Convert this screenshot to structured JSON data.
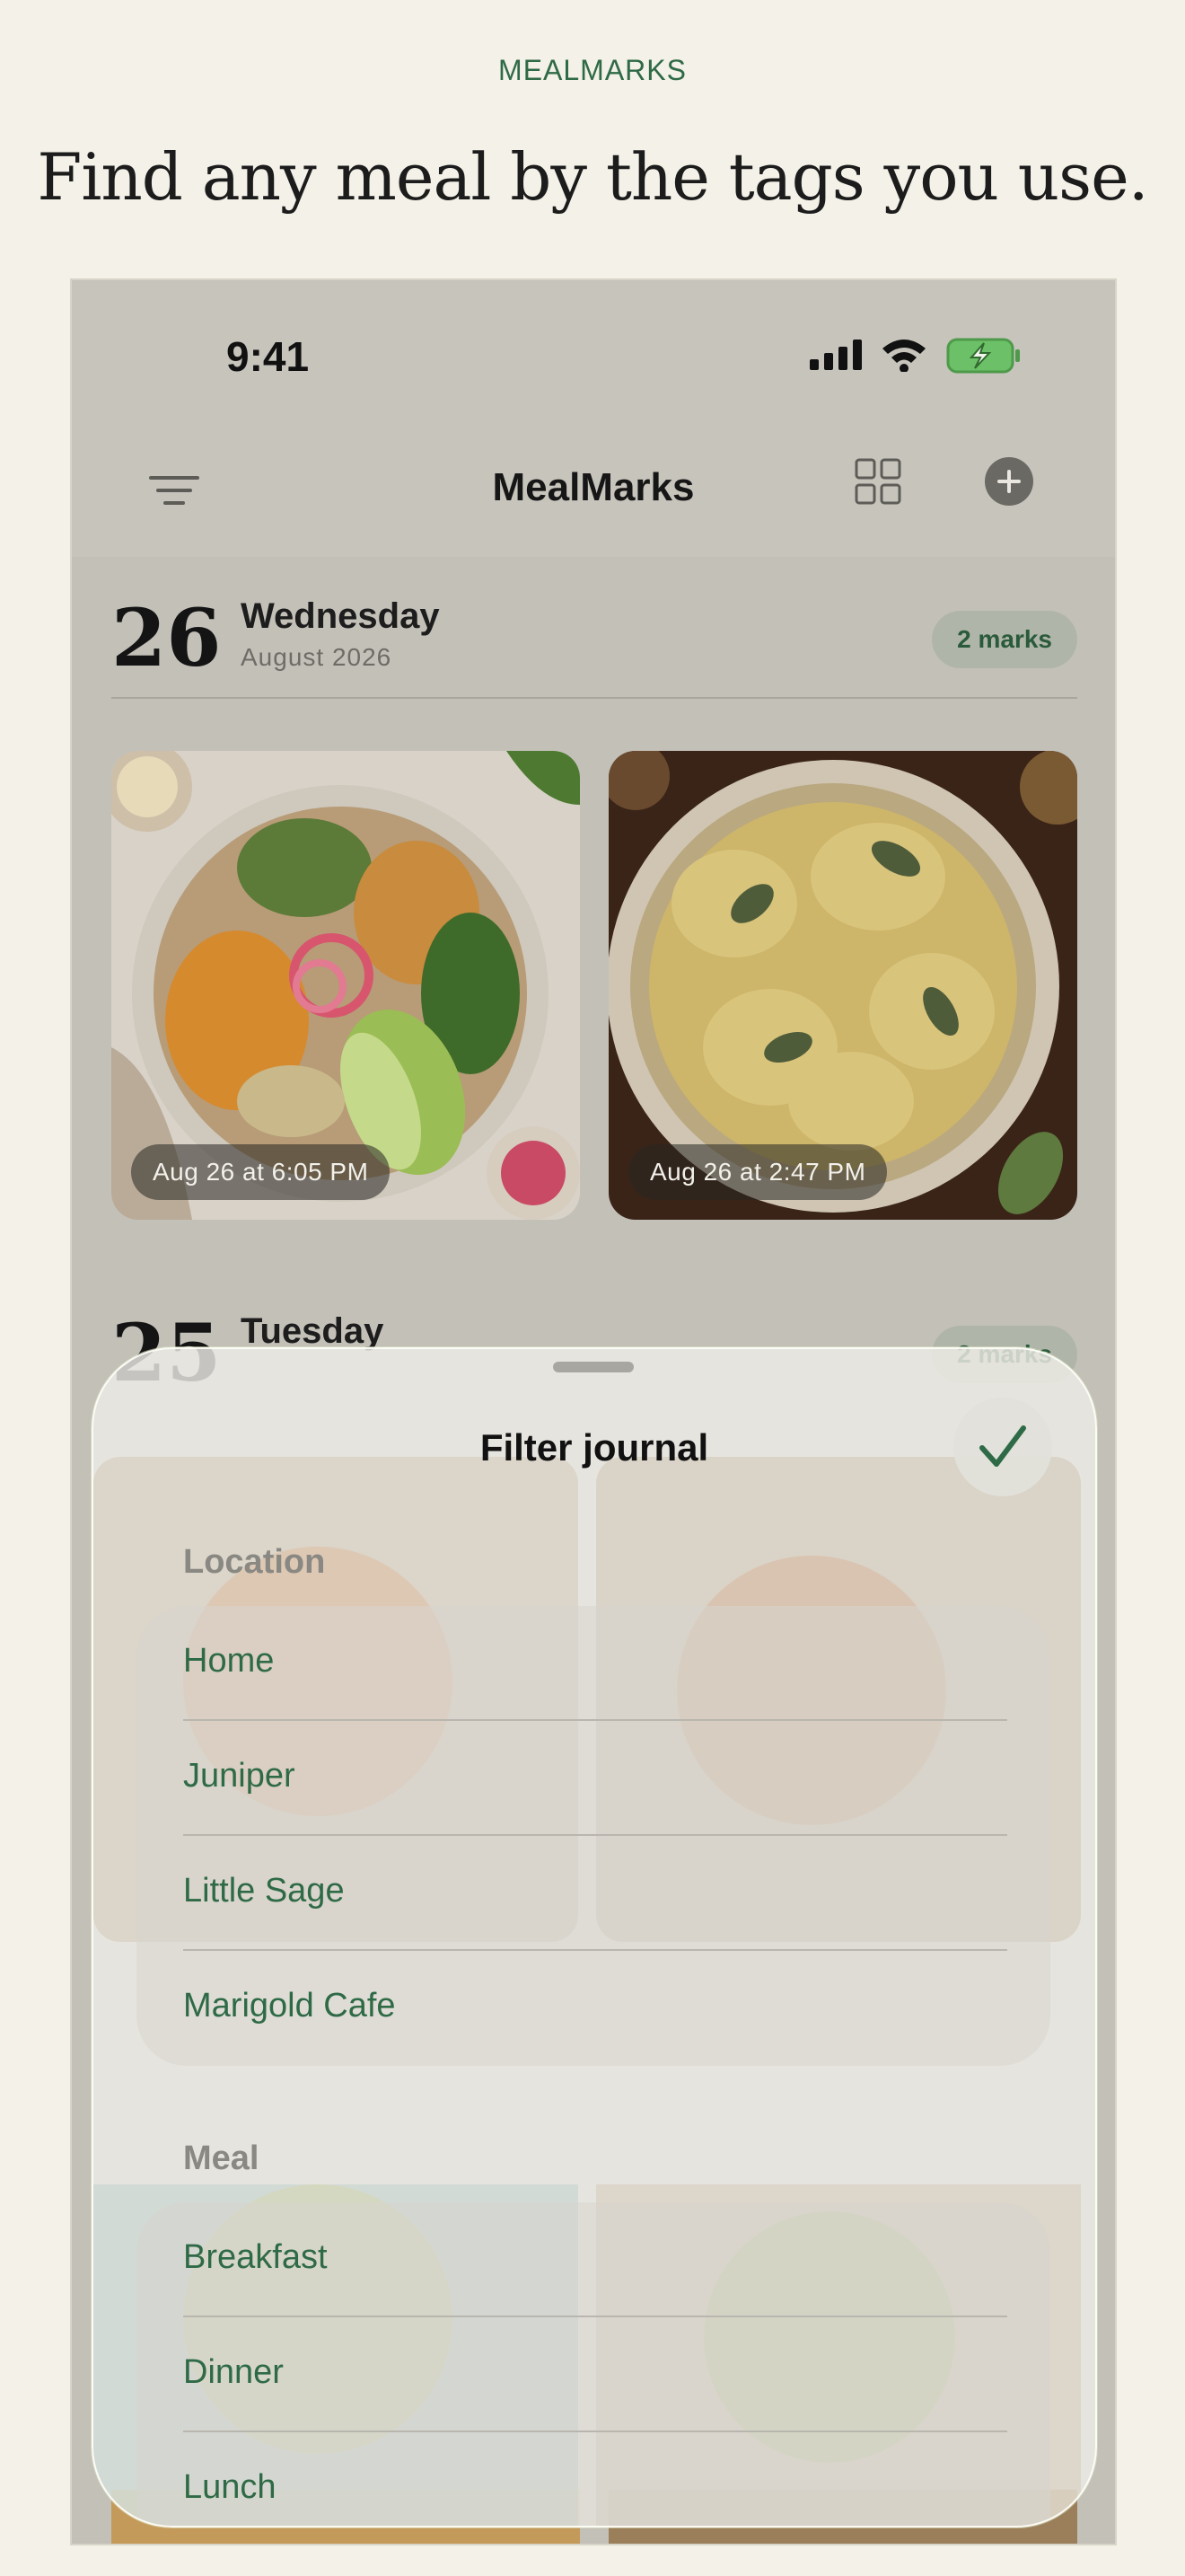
{
  "brand": "MEALMARKS",
  "headline": "Find any meal by the tags you use.",
  "status_bar": {
    "time": "9:41"
  },
  "nav": {
    "title": "MealMarks",
    "left_icon": "filter-lines-icon",
    "grid_icon": "grid-icon",
    "add_icon": "plus-circle-icon"
  },
  "days": [
    {
      "number": "26",
      "weekday": "Wednesday",
      "month": "August 2026",
      "badge": "2 marks",
      "photos": [
        {
          "caption": "Aug 26 at 6:05 PM",
          "subject": "grain bowl"
        },
        {
          "caption": "Aug 26 at 2:47 PM",
          "subject": "ravioli"
        }
      ]
    },
    {
      "number": "25",
      "weekday": "Tuesday",
      "badge": "2 marks"
    }
  ],
  "sheet": {
    "title": "Filter journal",
    "done_icon": "checkmark-icon",
    "sections": [
      {
        "label": "Location",
        "options": [
          "Home",
          "Juniper",
          "Little Sage",
          "Marigold Cafe"
        ]
      },
      {
        "label": "Meal",
        "options": [
          "Breakfast",
          "Dinner",
          "Lunch"
        ]
      }
    ]
  },
  "colors": {
    "background": "#f4f1e8",
    "accent_green": "#2f6a46",
    "badge_bg": "#afb5a8"
  }
}
